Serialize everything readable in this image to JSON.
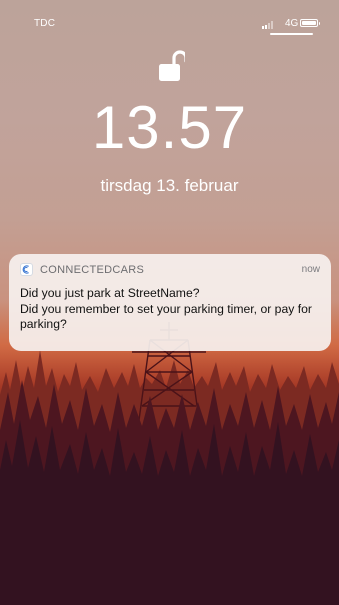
{
  "status_bar": {
    "carrier": "TDC",
    "network": "4G"
  },
  "lock_screen": {
    "time": "13.57",
    "date": "tirsdag 13. februar"
  },
  "notification": {
    "app_name": "CONNECTEDCARS",
    "timestamp": "now",
    "line1": "Did you just park at StreetName?",
    "line2": "Did you remember to set your parking timer, or pay for parking?"
  },
  "icons": {
    "lock": "unlocked-padlock-icon",
    "app": "connectedcars-logo-icon",
    "battery": "battery-icon",
    "signal": "signal-strength-icon"
  }
}
